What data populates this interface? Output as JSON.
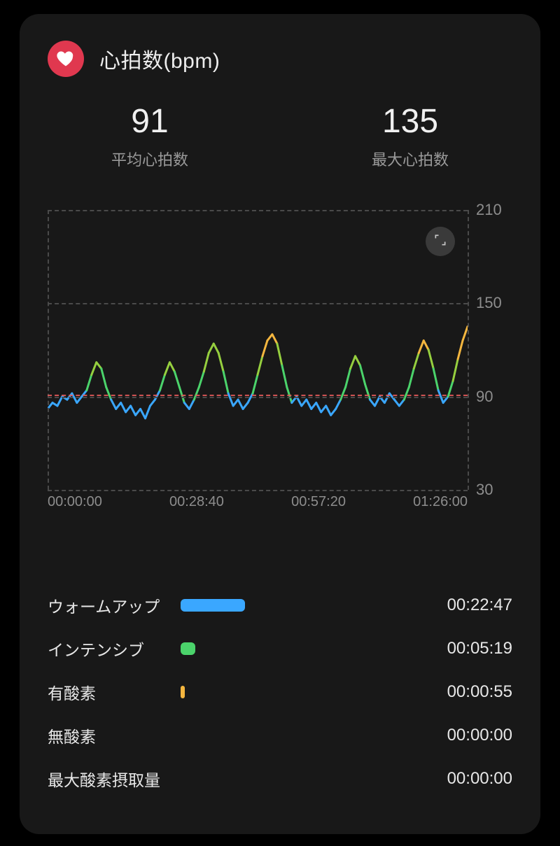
{
  "header": {
    "title": "心拍数(bpm)"
  },
  "stats": {
    "avg_value": "91",
    "avg_label": "平均心拍数",
    "max_value": "135",
    "max_label": "最大心拍数"
  },
  "chart_data": {
    "type": "line",
    "title": "心拍数(bpm)",
    "xlabel": "",
    "ylabel": "",
    "ylim": [
      30,
      210
    ],
    "x_ticks": [
      "00:00:00",
      "00:28:40",
      "00:57:20",
      "01:26:00"
    ],
    "y_ticks": [
      30,
      90,
      150,
      210
    ],
    "avg_line": 91,
    "series": [
      {
        "name": "heart-rate",
        "x_seconds": [
          0,
          60,
          120,
          180,
          240,
          300,
          360,
          420,
          480,
          540,
          600,
          660,
          720,
          780,
          840,
          900,
          960,
          1020,
          1080,
          1140,
          1200,
          1260,
          1320,
          1380,
          1440,
          1500,
          1560,
          1620,
          1680,
          1740,
          1800,
          1860,
          1920,
          1980,
          2040,
          2100,
          2160,
          2220,
          2280,
          2340,
          2400,
          2460,
          2520,
          2580,
          2640,
          2700,
          2760,
          2820,
          2880,
          2940,
          3000,
          3060,
          3120,
          3180,
          3240,
          3300,
          3360,
          3420,
          3480,
          3540,
          3600,
          3660,
          3720,
          3780,
          3840,
          3900,
          3960,
          4020,
          4080,
          4140,
          4200,
          4260,
          4320,
          4380,
          4440,
          4500,
          4560,
          4620,
          4680,
          4740,
          4800,
          4860,
          4920,
          4980,
          5040,
          5100,
          5160
        ],
        "values": [
          82,
          86,
          84,
          90,
          88,
          92,
          86,
          90,
          94,
          104,
          112,
          108,
          96,
          88,
          82,
          86,
          80,
          84,
          78,
          82,
          76,
          84,
          88,
          94,
          104,
          112,
          106,
          96,
          86,
          82,
          88,
          96,
          106,
          118,
          124,
          118,
          106,
          92,
          84,
          88,
          82,
          86,
          92,
          104,
          116,
          126,
          130,
          124,
          110,
          96,
          86,
          90,
          84,
          88,
          82,
          86,
          80,
          84,
          78,
          82,
          88,
          96,
          108,
          116,
          110,
          98,
          88,
          84,
          90,
          86,
          92,
          88,
          84,
          88,
          96,
          108,
          118,
          126,
          120,
          108,
          94,
          86,
          90,
          100,
          114,
          126,
          135
        ]
      }
    ],
    "color_bands": [
      {
        "upto": 95,
        "color": "#3aa7ff"
      },
      {
        "upto": 110,
        "color": "#4bd36b"
      },
      {
        "upto": 125,
        "color": "#96cf3f"
      },
      {
        "upto": 210,
        "color": "#f4b63f"
      }
    ]
  },
  "zones": [
    {
      "label": "ウォームアップ",
      "time": "00:22:47",
      "seconds": 1367,
      "color": "#3aa7ff"
    },
    {
      "label": "インテンシブ",
      "time": "00:05:19",
      "seconds": 319,
      "color": "#4bd36b"
    },
    {
      "label": "有酸素",
      "time": "00:00:55",
      "seconds": 55,
      "color": "#f4b63f"
    },
    {
      "label": "無酸素",
      "time": "00:00:00",
      "seconds": 0,
      "color": "#f06a3a"
    },
    {
      "label": "最大酸素摂取量",
      "time": "00:00:00",
      "seconds": 0,
      "color": "#e0384f"
    }
  ],
  "zone_bar_max_seconds": 5160
}
